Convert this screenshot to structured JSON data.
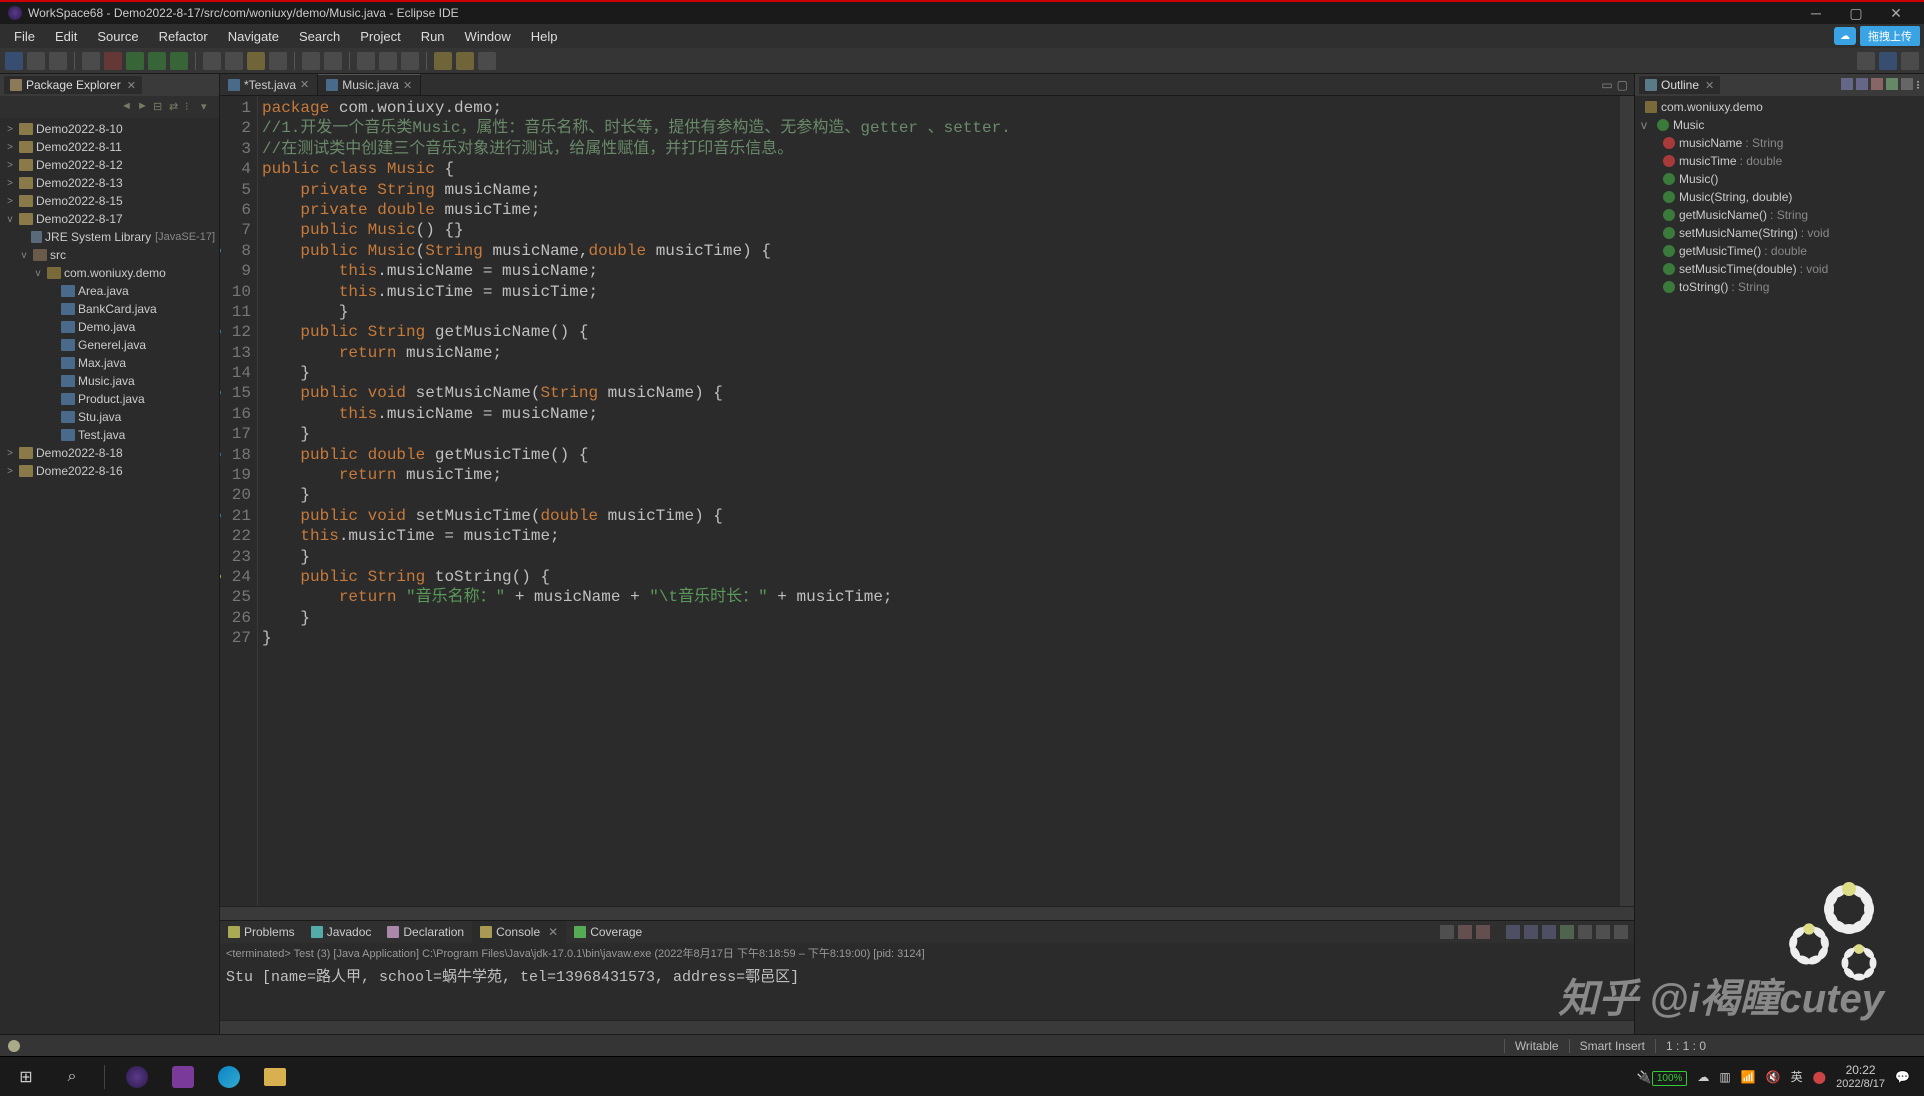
{
  "window": {
    "title": "WorkSpace68 - Demo2022-8-17/src/com/woniuxy/demo/Music.java - Eclipse IDE"
  },
  "menu": [
    "File",
    "Edit",
    "Source",
    "Refactor",
    "Navigate",
    "Search",
    "Project",
    "Run",
    "Window",
    "Help"
  ],
  "cloud_button": "拖拽上传",
  "package_explorer": {
    "title": "Package Explorer",
    "projects": [
      {
        "name": "Demo2022-8-10",
        "expanded": false
      },
      {
        "name": "Demo2022-8-11",
        "expanded": false
      },
      {
        "name": "Demo2022-8-12",
        "expanded": false
      },
      {
        "name": "Demo2022-8-13",
        "expanded": false
      },
      {
        "name": "Demo2022-8-15",
        "expanded": false
      },
      {
        "name": "Demo2022-8-17",
        "expanded": true,
        "children": [
          {
            "name": "JRE System Library",
            "suffix": "[JavaSE-17]",
            "type": "lib",
            "expanded": false
          },
          {
            "name": "src",
            "type": "src",
            "expanded": true,
            "children": [
              {
                "name": "com.woniuxy.demo",
                "type": "pkg",
                "expanded": true,
                "children": [
                  {
                    "name": "Area.java",
                    "type": "java"
                  },
                  {
                    "name": "BankCard.java",
                    "type": "java"
                  },
                  {
                    "name": "Demo.java",
                    "type": "java"
                  },
                  {
                    "name": "Generel.java",
                    "type": "java"
                  },
                  {
                    "name": "Max.java",
                    "type": "java"
                  },
                  {
                    "name": "Music.java",
                    "type": "java"
                  },
                  {
                    "name": "Product.java",
                    "type": "java"
                  },
                  {
                    "name": "Stu.java",
                    "type": "java"
                  },
                  {
                    "name": "Test.java",
                    "type": "java"
                  }
                ]
              }
            ]
          }
        ]
      },
      {
        "name": "Demo2022-8-18",
        "expanded": false
      },
      {
        "name": "Dome2022-8-16",
        "expanded": false
      }
    ]
  },
  "editor": {
    "tabs": [
      {
        "name": "*Test.java",
        "active": false
      },
      {
        "name": "Music.java",
        "active": true
      }
    ],
    "lines": [
      {
        "n": 1,
        "html": "<span class='kw'>package</span> com.woniuxy.demo;"
      },
      {
        "n": 2,
        "html": "<span class='com'>//1.开发一个音乐类Music，属性：音乐名称、时长等，提供有参构造、无参构造、getter 、setter.</span>"
      },
      {
        "n": 3,
        "html": "<span class='com'>//在测试类中创建三个音乐对象进行测试，给属性赋值，并打印音乐信息。</span>"
      },
      {
        "n": 4,
        "html": "<span class='kw'>public</span> <span class='kw'>class</span> <span class='type'>Music</span> {"
      },
      {
        "n": 5,
        "html": "    <span class='kw'>private</span> <span class='type'>String</span> musicName;"
      },
      {
        "n": 6,
        "html": "    <span class='kw'>private</span> <span class='kw'>double</span> musicTime;"
      },
      {
        "n": 7,
        "html": "    <span class='kw'>public</span> <span class='type'>Music</span>() {}"
      },
      {
        "n": 8,
        "mark": "blue",
        "html": "    <span class='kw'>public</span> <span class='type'>Music</span>(<span class='type'>String</span> musicName,<span class='kw'>double</span> musicTime) {"
      },
      {
        "n": 9,
        "html": "        <span class='kw'>this</span>.musicName = musicName;"
      },
      {
        "n": 10,
        "html": "        <span class='kw'>this</span>.musicTime = musicTime;"
      },
      {
        "n": 11,
        "html": "        }"
      },
      {
        "n": 12,
        "mark": "blue",
        "html": "    <span class='kw'>public</span> <span class='type'>String</span> getMusicName() {"
      },
      {
        "n": 13,
        "html": "        <span class='kw'>return</span> musicName;"
      },
      {
        "n": 14,
        "html": "    }"
      },
      {
        "n": 15,
        "mark": "blue",
        "html": "    <span class='kw'>public</span> <span class='kw'>void</span> setMusicName(<span class='type'>String</span> musicName) {"
      },
      {
        "n": 16,
        "html": "        <span class='kw'>this</span>.musicName = musicName;"
      },
      {
        "n": 17,
        "html": "    }"
      },
      {
        "n": 18,
        "mark": "blue",
        "html": "    <span class='kw'>public</span> <span class='kw'>double</span> getMusicTime() {"
      },
      {
        "n": 19,
        "html": "        <span class='kw'>return</span> musicTime;"
      },
      {
        "n": 20,
        "html": "    }"
      },
      {
        "n": 21,
        "mark": "blue",
        "html": "    <span class='kw'>public</span> <span class='kw'>void</span> setMusicTime(<span class='kw'>double</span> musicTime) {"
      },
      {
        "n": 22,
        "html": "    <span class='kw'>this</span>.musicTime = musicTime;"
      },
      {
        "n": 23,
        "html": "    }"
      },
      {
        "n": 24,
        "mark": "yellow",
        "html": "    <span class='kw'>public</span> <span class='type'>String</span> toString() {"
      },
      {
        "n": 25,
        "html": "        <span class='kw'>return</span> <span class='str'>\"音乐名称：\"</span> + musicName + <span class='str'>\"\\t音乐时长：\"</span> + musicTime;"
      },
      {
        "n": 26,
        "html": "    }"
      },
      {
        "n": 27,
        "html": "}"
      }
    ]
  },
  "outline": {
    "title": "Outline",
    "items": [
      {
        "icon": "pkg",
        "label": "com.woniuxy.demo",
        "indent": 0
      },
      {
        "icon": "cls",
        "label": "Music",
        "indent": 0,
        "exp": "v"
      },
      {
        "icon": "fld",
        "label": "musicName",
        "type": ": String",
        "indent": 1
      },
      {
        "icon": "fld",
        "label": "musicTime",
        "type": ": double",
        "indent": 1
      },
      {
        "icon": "mth",
        "label": "Music()",
        "indent": 1
      },
      {
        "icon": "mth",
        "label": "Music(String, double)",
        "indent": 1
      },
      {
        "icon": "mth",
        "label": "getMusicName()",
        "type": ": String",
        "indent": 1
      },
      {
        "icon": "mth",
        "label": "setMusicName(String)",
        "type": ": void",
        "indent": 1
      },
      {
        "icon": "mth",
        "label": "getMusicTime()",
        "type": ": double",
        "indent": 1
      },
      {
        "icon": "mth",
        "label": "setMusicTime(double)",
        "type": ": void",
        "indent": 1
      },
      {
        "icon": "mth",
        "label": "toString()",
        "type": ": String",
        "indent": 1
      }
    ]
  },
  "bottom": {
    "tabs": [
      "Problems",
      "Javadoc",
      "Declaration",
      "Console",
      "Coverage"
    ],
    "active_tab": "Console",
    "console_info": "<terminated> Test (3) [Java Application] C:\\Program Files\\Java\\jdk-17.0.1\\bin\\javaw.exe  (2022年8月17日 下午8:18:59 – 下午8:19:00) [pid: 3124]",
    "console_out": "Stu [name=路人甲, school=蜗牛学苑, tel=13968431573, address=鄠邑区]"
  },
  "statusbar": {
    "writable": "Writable",
    "insert": "Smart Insert",
    "pos": "1 : 1 : 0"
  },
  "taskbar": {
    "battery": "100%",
    "time": "20:22",
    "date": "2022/8/17",
    "lang": "英"
  },
  "watermark": "知乎 @i褐瞳cutey"
}
